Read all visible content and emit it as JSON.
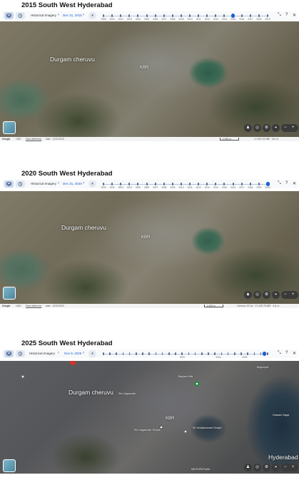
{
  "toolbar": {
    "historical_imagery": "Historical Imagery"
  },
  "panels": [
    {
      "title": "2015 South West Hyderabad",
      "date": "Dec 31, 2015",
      "years": [
        "1999",
        "2000",
        "2002",
        "2003",
        "2004",
        "2005",
        "2006",
        "2007",
        "2008",
        "2009",
        "2010",
        "2011",
        "2012",
        "2013",
        "2014",
        "2015",
        "2016",
        "2017",
        "2018",
        "2019"
      ],
      "labels": {
        "lake": "Durgam cheruvu",
        "park": "KBR"
      },
      "status": {
        "google": "Google",
        "data": "1000",
        "attribution": "Data attribution",
        "date_note": "date · 12/31/2015",
        "scale": "2,000 m",
        "coords": "17.42N 78.38E · 411 m"
      }
    },
    {
      "title": "2020 South West Hyderabad",
      "date": "Dec 31, 2020",
      "years": [
        "2000",
        "2002",
        "2003",
        "2004",
        "2005",
        "2006",
        "2007",
        "2008",
        "2009",
        "2010",
        "2011",
        "2012",
        "2013",
        "2014",
        "2015",
        "2016",
        "2017",
        "2018",
        "2019",
        "2020"
      ],
      "labels": {
        "lake": "Durgam cheruvu",
        "park": "KBR"
      },
      "status": {
        "google": "Google",
        "data": "1000",
        "attribution": "Data attribution",
        "date_note": "date · 12/31/2020",
        "scale": "2,000 m",
        "coords": "Camera: 22 km · 17.42N 78.38E · 411 m"
      }
    },
    {
      "title": "2025 South West Hyderabad",
      "date": "Nov 9, 2025",
      "years": [
        "2023",
        "2024",
        "2025"
      ],
      "labels": {
        "lake": "Durgam cheruvu",
        "park": "KBR",
        "city": "Hyderabad",
        "area": "MEHDIPATNAM",
        "district": "Begumpet",
        "poi1": "Shri Jagannath Temple",
        "poi2": "Sri Venkateswara Temple",
        "poi3": "Shri Jagannath",
        "poi4": "Hussain Sagar",
        "poi5": "Banjara Hills"
      }
    }
  ],
  "icons": [
    "layers-icon",
    "clock-icon",
    "chevron-left-icon",
    "chevron-right-icon",
    "play-icon",
    "close-icon",
    "collapse-icon",
    "help-icon",
    "settings-icon",
    "pegman-icon",
    "compass-icon",
    "zoom-in-icon",
    "zoom-out-icon",
    "location-icon",
    "pin-icon"
  ],
  "colors": {
    "accent": "#1a5fd1",
    "pin_red": "#d93025",
    "pin_green": "#1e8e3e"
  }
}
